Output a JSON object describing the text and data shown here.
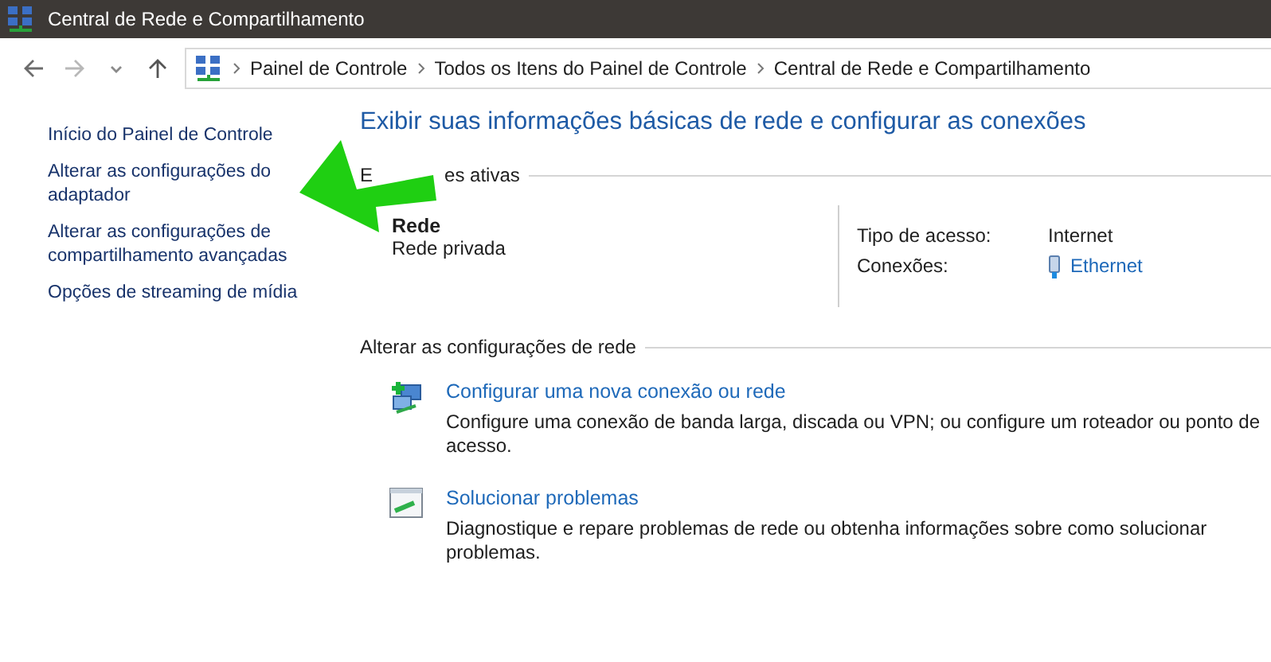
{
  "window": {
    "title": "Central de Rede e Compartilhamento"
  },
  "navigation": {
    "breadcrumbs": [
      "Painel de Controle",
      "Todos os Itens do Painel de Controle",
      "Central de Rede e Compartilhamento"
    ]
  },
  "sidebar": {
    "items": [
      "Início do Painel de Controle",
      "Alterar as configurações do adaptador",
      "Alterar as configurações de compartilhamento avançadas",
      "Opções de streaming de mídia"
    ]
  },
  "heading": "Exibir suas informações básicas de rede e configurar as conexões",
  "active_networks": {
    "label_start": "E",
    "label_end": "es ativas",
    "network": {
      "name": "Rede",
      "profile": "Rede privada",
      "access_type_label": "Tipo de acesso:",
      "access_type": "Internet",
      "connections_label": "Conexões:",
      "connection": "Ethernet"
    }
  },
  "change_settings": {
    "label": "Alterar as configurações de rede",
    "tasks": [
      {
        "kind": "new-connection",
        "title": "Configurar uma nova conexão ou rede",
        "description": "Configure uma conexão de banda larga, discada ou VPN; ou configure um roteador ou ponto de acesso."
      },
      {
        "kind": "troubleshoot",
        "title": "Solucionar problemas",
        "description": "Diagnostique e repare problemas de rede ou obtenha informações sobre como solucionar problemas."
      }
    ]
  }
}
